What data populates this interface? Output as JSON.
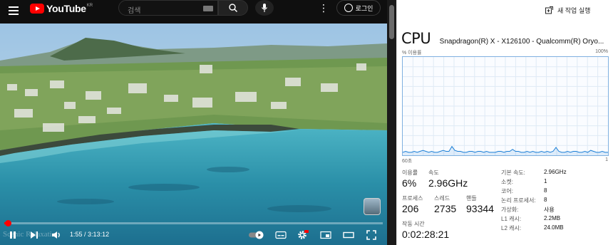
{
  "youtube": {
    "logo_text": "YouTube",
    "logo_region": "KR",
    "search_placeholder": "검색",
    "login_label": "로그인",
    "time_current": "1:55",
    "time_separator": " / ",
    "time_total": "3:13:12",
    "progress_fraction": 0.01,
    "watermark": "Scenic Relaxation",
    "brand_color": "#ff0000"
  },
  "taskmanager": {
    "new_task_label": "새 작업 실행",
    "title": "CPU",
    "processor": "Snapdragon(R) X - X126100 - Qualcomm(R) Oryo...",
    "graph_label": "% 이용률",
    "graph_max": "100%",
    "graph_time": "60초",
    "graph_zero": "1",
    "graph_color": "#1c7fd6",
    "stats": {
      "utilization_label": "이용률",
      "utilization_value": "6%",
      "speed_label": "속도",
      "speed_value": "2.96GHz",
      "processes_label": "프로세스",
      "processes_value": "206",
      "threads_label": "스레드",
      "threads_value": "2735",
      "handles_label": "핸들",
      "handles_value": "93344",
      "uptime_label": "작동 시간",
      "uptime_value": "0:02:28:21"
    },
    "specs": [
      {
        "label": "기본 속도:",
        "value": "2.96GHz"
      },
      {
        "label": "소켓:",
        "value": "1"
      },
      {
        "label": "코어:",
        "value": "8"
      },
      {
        "label": "논리 프로세서:",
        "value": "8"
      },
      {
        "label": "가상화:",
        "value": "사용"
      },
      {
        "label": "L1 캐시:",
        "value": "2.2MB"
      },
      {
        "label": "L2 캐시:",
        "value": "24.0MB"
      }
    ],
    "cpu_history": [
      3,
      4,
      3,
      3,
      4,
      3,
      4,
      5,
      4,
      3,
      4,
      3,
      3,
      4,
      5,
      4,
      4,
      9,
      5,
      4,
      4,
      3,
      3,
      4,
      4,
      3,
      4,
      4,
      3,
      4,
      3,
      3,
      3,
      4,
      4,
      3,
      4,
      4,
      6,
      4,
      4,
      3,
      3,
      4,
      3,
      4,
      3,
      3,
      4,
      3,
      4,
      3,
      4,
      8,
      4,
      3,
      3,
      4,
      3,
      4,
      4,
      3,
      3,
      4,
      3,
      5,
      4,
      3,
      3,
      4,
      3,
      3
    ]
  }
}
